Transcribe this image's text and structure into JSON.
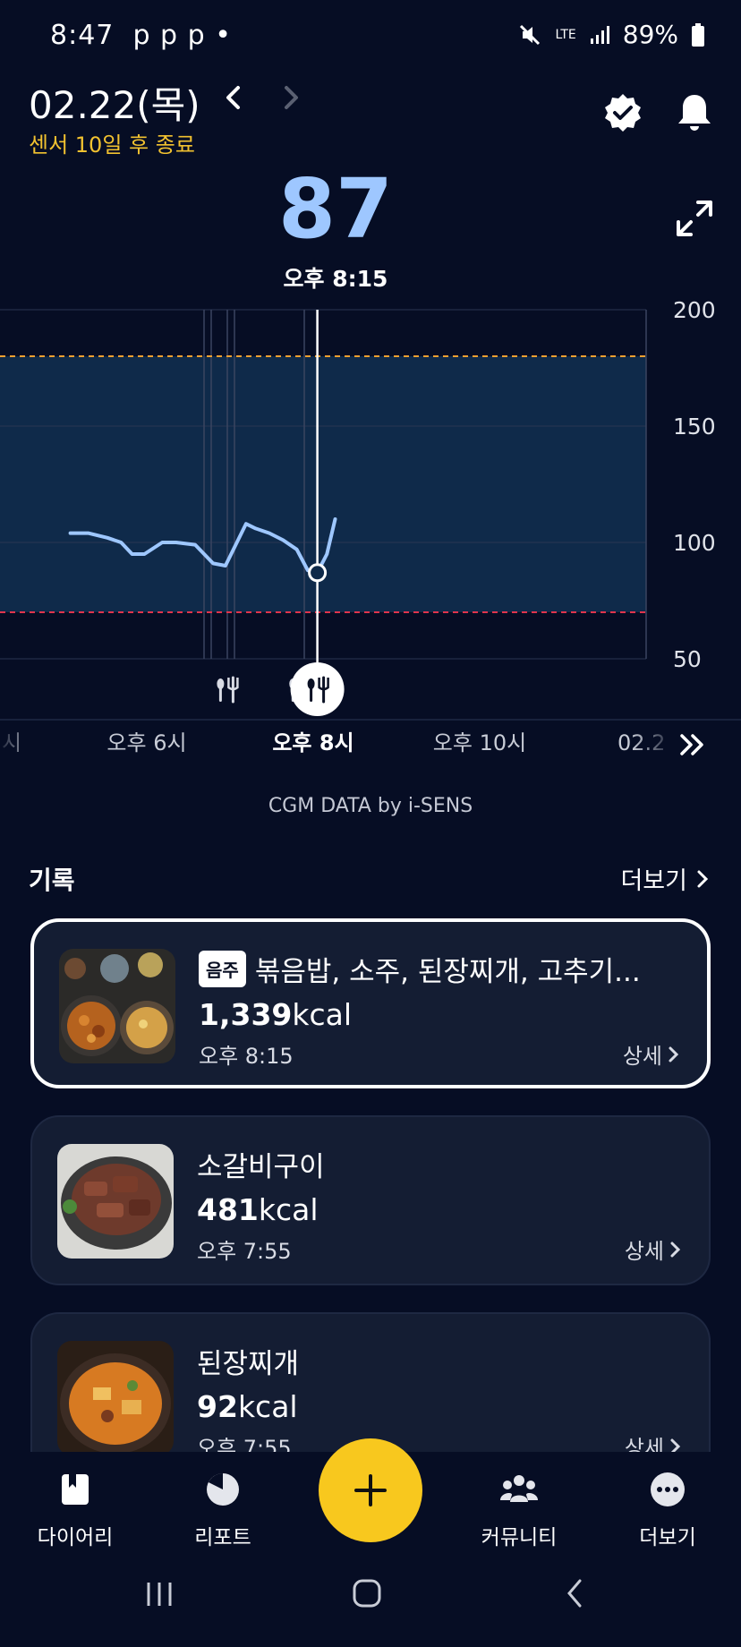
{
  "status_bar": {
    "time": "8:47",
    "notifications": "p p p •",
    "network": "LTE",
    "battery": "89%"
  },
  "header": {
    "date": "02.22(목)",
    "sensor_notice": "센서 10일 후 종료"
  },
  "glucose": {
    "value": "87",
    "time": "오후 8:15"
  },
  "chart_data": {
    "type": "line",
    "y_ticks": [
      "200",
      "150",
      "100",
      "50"
    ],
    "ylim": [
      50,
      200
    ],
    "target_range": [
      70,
      180
    ],
    "x_ticks": [
      "시",
      "오후 6시",
      "오후 8시",
      "오후 10시",
      "02.2"
    ],
    "series": [
      {
        "values": [
          {
            "t": "17:03",
            "y": 104
          },
          {
            "t": "17:16",
            "y": 104
          },
          {
            "t": "17:30",
            "y": 102
          },
          {
            "t": "17:40",
            "y": 100
          },
          {
            "t": "17:48",
            "y": 95
          },
          {
            "t": "17:57",
            "y": 95
          },
          {
            "t": "18:10",
            "y": 100
          },
          {
            "t": "18:20",
            "y": 100
          },
          {
            "t": "18:34",
            "y": 99
          },
          {
            "t": "18:47",
            "y": 91
          },
          {
            "t": "18:56",
            "y": 90
          },
          {
            "t": "19:11",
            "y": 108
          },
          {
            "t": "19:18",
            "y": 106
          },
          {
            "t": "19:28",
            "y": 104
          },
          {
            "t": "19:38",
            "y": 101
          },
          {
            "t": "19:48",
            "y": 97
          },
          {
            "t": "19:56",
            "y": 88
          },
          {
            "t": "20:03",
            "y": 87
          },
          {
            "t": "20:10",
            "y": 95
          },
          {
            "t": "20:16",
            "y": 110
          }
        ]
      }
    ],
    "selected_point": {
      "t": "20:03",
      "y": 87
    },
    "meal_markers": [
      "18:57",
      "19:53",
      "20:03"
    ]
  },
  "credit": "CGM DATA by i-SENS",
  "records": {
    "title": "기록",
    "more": "더보기",
    "items": [
      {
        "badge": "음주",
        "name": "볶음밥, 소주, 된장찌개, 고추기...",
        "kcal_num": "1,339",
        "kcal_unit": "kcal",
        "time": "오후 8:15",
        "detail": "상세"
      },
      {
        "badge": "",
        "name": "소갈비구이",
        "kcal_num": "481",
        "kcal_unit": "kcal",
        "time": "오후 7:55",
        "detail": "상세"
      },
      {
        "badge": "",
        "name": "된장찌개",
        "kcal_num": "92",
        "kcal_unit": "kcal",
        "time": "오후 7:55",
        "detail": "상세"
      }
    ]
  },
  "bottom_nav": {
    "diary": "다이어리",
    "report": "리포트",
    "community": "커뮤니티",
    "more": "더보기"
  },
  "colors": {
    "background": "#060d24",
    "accent": "#f8c81e",
    "glucose": "#9ec7ff",
    "target_band": "#0f2a4a",
    "high_limit": "#f0a030",
    "low_limit": "#e0344c"
  }
}
